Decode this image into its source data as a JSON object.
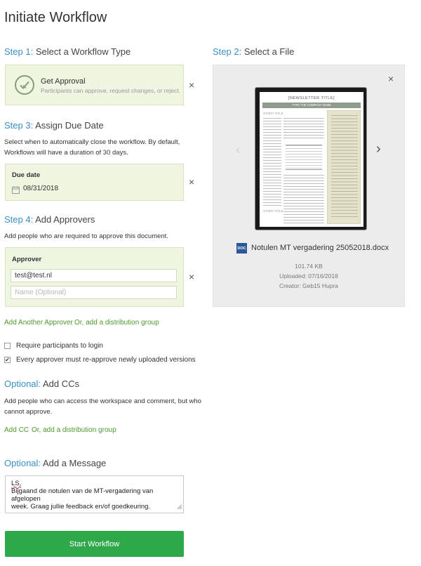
{
  "page": {
    "title": "Initiate Workflow"
  },
  "step1": {
    "num": "Step 1:",
    "title": "Select a Workflow Type",
    "type_title": "Get Approval",
    "type_desc": "Participants can approve, request changes, or reject.",
    "close": "×"
  },
  "step2": {
    "num": "Step 2:",
    "title": "Select a File",
    "close": "×",
    "prev": "‹",
    "next": "›",
    "preview": {
      "newsletter_title": "[NEWSLETTER TITLE]",
      "company_name": "TYPE THE COMPANY NAME",
      "story_title": "STORY TITLE",
      "story_title_2": "STORY TITLE"
    },
    "file_badge": "DOC",
    "file_name": "Notulen MT vergadering 25052018.docx",
    "file_size": "101.74 KB",
    "uploaded": "Uploaded: 07/16/2018",
    "creator": "Creator: Geb15 Hupra"
  },
  "step3": {
    "num": "Step 3:",
    "title": "Assign Due Date",
    "desc_line1": "Select when to automatically close the workflow. By default,",
    "desc_line2": "Workflows will have a duration of 30 days.",
    "due_label": "Due date",
    "due_value": "08/31/2018",
    "close": "×"
  },
  "step4": {
    "num": "Step 4:",
    "title": "Add Approvers",
    "desc": "Add people who are required to approve this document.",
    "approver_label": "Approver",
    "approver_value": "test@test.nl",
    "name_placeholder": "Name (Optional)",
    "close": "×",
    "add_another": "Add Another Approver",
    "add_group": "Or, add a distribution group"
  },
  "options": {
    "require_login": "Require participants to login",
    "require_login_checked": false,
    "reapprove": "Every approver must re-approve newly uploaded versions",
    "reapprove_checked": true,
    "check_glyph": "✔"
  },
  "ccs": {
    "optional": "Optional:",
    "title": "Add CCs",
    "desc_line1": "Add people who can access the workspace and comment, but who",
    "desc_line2": "cannot approve.",
    "add_cc": "Add CC",
    "add_group": "Or, add a distribution group"
  },
  "message": {
    "optional": "Optional:",
    "title": "Add a Message",
    "line1": "LS,",
    "line2": "Bijgaand de notulen van de MT-vergadering van afgelopen",
    "line3": "week. Graag jullie feedback en/of goedkeuring."
  },
  "actions": {
    "start": "Start Workflow"
  },
  "colors": {
    "accent_blue": "#3a8fc6",
    "green_link": "#4c9a2e",
    "green_box": "#eef5e1",
    "start_button": "#2fa84a"
  }
}
